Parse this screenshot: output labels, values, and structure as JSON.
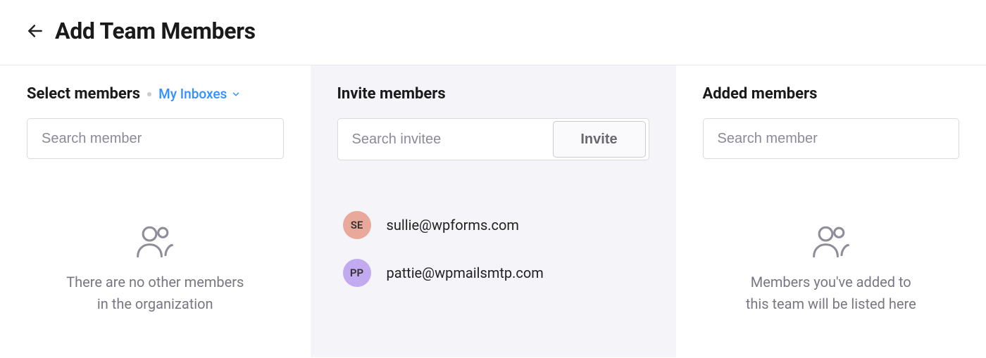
{
  "header": {
    "title": "Add Team Members"
  },
  "select_col": {
    "heading": "Select members",
    "filter_label": "My Inboxes",
    "search_placeholder": "Search member",
    "empty_text": "There are no other members\nin the organization"
  },
  "invite_col": {
    "heading": "Invite members",
    "search_placeholder": "Search invitee",
    "invite_button": "Invite",
    "invitees": [
      {
        "initials": "SE",
        "email": "sullie@wpforms.com",
        "avatar_color": "#e9a99a"
      },
      {
        "initials": "PP",
        "email": "pattie@wpmailsmtp.com",
        "avatar_color": "#c1aaf0"
      }
    ]
  },
  "added_col": {
    "heading": "Added members",
    "search_placeholder": "Search member",
    "empty_text": "Members you've added to\nthis team will be listed here"
  }
}
